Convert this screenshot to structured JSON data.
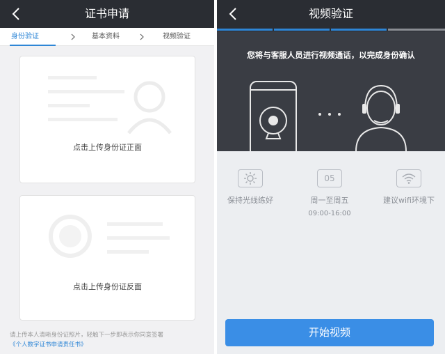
{
  "left_screen": {
    "title": "证书申请",
    "steps": [
      "身份验证",
      "基本资料",
      "视频验证"
    ],
    "active_step_index": 0,
    "front_card_label": "点击上传身份证正面",
    "back_card_label": "点击上传身份证反面",
    "consent_text": "请上传本人清晰身份证照片，轻触下一步即表示你同意签署",
    "consent_link": "《个人数字证书申请责任书》"
  },
  "right_screen": {
    "title": "视频验证",
    "progress_segments_filled": 3,
    "progress_segments_total": 4,
    "hero_message": "您将与客服人员进行视频通话，以完成身份确认",
    "tips": [
      {
        "icon": "sun-icon",
        "label": "保持光线练好",
        "sub": ""
      },
      {
        "icon": "calendar-icon",
        "icon_text": "05",
        "label": "周一至周五",
        "sub": "09:00-16:00"
      },
      {
        "icon": "wifi-icon",
        "label": "建议wifi环境下",
        "sub": ""
      }
    ],
    "start_button": "开始视频"
  },
  "colors": {
    "topbar": "#2a2d33",
    "accent": "#2e86d6",
    "button": "#3a8ee6",
    "hero_bg": "#3a3d44",
    "hero_line": "#e8e8e8"
  }
}
